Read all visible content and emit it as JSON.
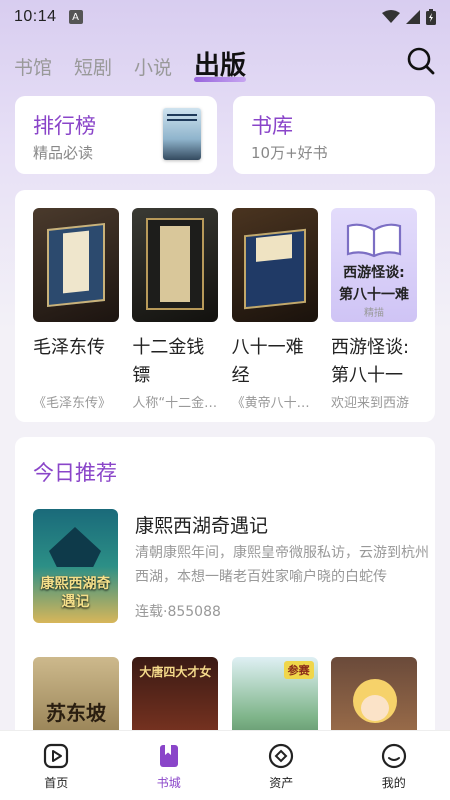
{
  "status": {
    "time": "10:14",
    "sim_badge": "A",
    "icons": [
      "wifi-icon",
      "signal-icon",
      "battery-icon"
    ]
  },
  "tabs": [
    {
      "label": "书馆"
    },
    {
      "label": "短剧"
    },
    {
      "label": "小说"
    },
    {
      "label": "出版",
      "active": true
    }
  ],
  "quick": {
    "ranking": {
      "title": "排行榜",
      "sub": "精品必读"
    },
    "library": {
      "title": "书库",
      "sub": "10万+好书"
    }
  },
  "shelf": [
    {
      "title": "毛泽东传",
      "desc": "《毛泽东传》"
    },
    {
      "title": "十二金钱镖",
      "desc": "人称“十二金钱镖”"
    },
    {
      "title": "八十一难经",
      "desc": "《黄帝八十一难经》"
    },
    {
      "title": "西游怪谈:第八十一难",
      "desc": "欢迎来到西游",
      "cover_text": "西游怪谈:第八十一难",
      "cover_tag": "精描"
    }
  ],
  "today": {
    "title": "今日推荐",
    "feature": {
      "title": "康熙西湖奇遇记",
      "desc": "清朝康熙年间，康熙皇帝微服私访，云游到杭州西湖，本想一睹老百姓家喻户晓的白蛇传",
      "meta": "连载·855088",
      "cover_text": "康熙西湖奇遇记"
    },
    "more": [
      {
        "cover_text": "苏东坡"
      },
      {
        "cover_text": "大唐四大才女"
      },
      {
        "cover_text": "参赛"
      },
      {
        "cover_text": ""
      }
    ]
  },
  "nav": [
    {
      "label": "首页",
      "icon": "play-icon"
    },
    {
      "label": "书城",
      "icon": "bookmark-icon",
      "active": true
    },
    {
      "label": "资产",
      "icon": "diamond-icon"
    },
    {
      "label": "我的",
      "icon": "smile-icon"
    }
  ],
  "colors": {
    "accent": "#8a45c9",
    "bg": "#f3f1f7"
  }
}
